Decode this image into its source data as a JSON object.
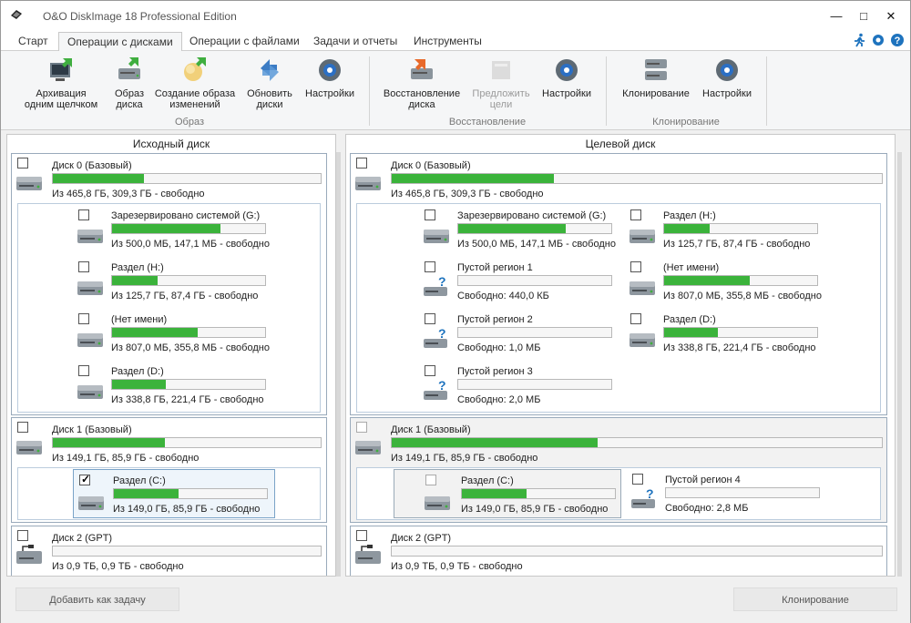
{
  "window": {
    "title": "O&O DiskImage 18 Professional Edition"
  },
  "tabs": [
    "Старт",
    "Операции с дисками",
    "Операции с файлами",
    "Задачи и отчеты",
    "Инструменты"
  ],
  "ribbon": {
    "image": {
      "label": "Образ",
      "one_click": "Архивация\nодним щелчком",
      "image_disk": "Образ\nдиска",
      "image_changes": "Создание образа\nизменений",
      "refresh": "Обновить\nдиски",
      "settings": "Настройки"
    },
    "restore": {
      "label": "Восстановление",
      "restore_disk": "Восстановление\nдиска",
      "suggest": "Предложить\nцели",
      "settings": "Настройки"
    },
    "clone": {
      "label": "Клонирование",
      "clone": "Клонирование",
      "settings": "Настройки"
    }
  },
  "source": {
    "title": "Исходный диск",
    "disk0": {
      "name": "Диск 0 (Базовый)",
      "info": "Из 465,8 ГБ, 309,3 ГБ - свободно",
      "used": 0.34
    },
    "disk0_parts": [
      {
        "name": "Зарезервировано системой (G:)",
        "info": "Из 500,0 МБ, 147,1 МБ - свободно",
        "used": 0.71
      },
      {
        "name": "Раздел (H:)",
        "info": "Из 125,7 ГБ, 87,4 ГБ - свободно",
        "used": 0.3
      },
      {
        "name": "(Нет имени)",
        "info": "Из 807,0 МБ, 355,8 МБ - свободно",
        "used": 0.56
      },
      {
        "name": "Раздел (D:)",
        "info": "Из 338,8 ГБ, 221,4 ГБ - свободно",
        "used": 0.35
      }
    ],
    "disk1": {
      "name": "Диск 1 (Базовый)",
      "info": "Из 149,1 ГБ, 85,9 ГБ - свободно",
      "used": 0.42
    },
    "disk1_part": {
      "name": "Раздел (C:)",
      "info": "Из 149,0 ГБ, 85,9 ГБ - свободно",
      "used": 0.42
    },
    "disk2": {
      "name": "Диск 2 (GPT)",
      "info": "Из 0,9 ТБ, 0,9 ТБ - свободно",
      "used": 0.0
    }
  },
  "target": {
    "title": "Целевой диск",
    "disk0": {
      "name": "Диск 0 (Базовый)",
      "info": "Из 465,8 ГБ, 309,3 ГБ - свободно",
      "used": 0.33
    },
    "disk0_left": [
      {
        "name": "Зарезервировано системой (G:)",
        "info": "Из 500,0 МБ, 147,1 МБ - свободно",
        "used": 0.7,
        "icon": "hdd"
      },
      {
        "name": "Пустой регион 1",
        "info": "Свободно: 440,0 КБ",
        "used": 0.0,
        "icon": "unknown"
      },
      {
        "name": "Пустой регион 2",
        "info": "Свободно: 1,0 МБ",
        "used": 0.0,
        "icon": "unknown"
      },
      {
        "name": "Пустой регион 3",
        "info": "Свободно: 2,0 МБ",
        "used": 0.0,
        "icon": "unknown"
      }
    ],
    "disk0_right": [
      {
        "name": "Раздел (H:)",
        "info": "Из 125,7 ГБ, 87,4 ГБ - свободно",
        "used": 0.3,
        "icon": "hdd"
      },
      {
        "name": "(Нет имени)",
        "info": "Из 807,0 МБ, 355,8 МБ - свободно",
        "used": 0.56,
        "icon": "hdd"
      },
      {
        "name": "Раздел (D:)",
        "info": "Из 338,8 ГБ, 221,4 ГБ - свободно",
        "used": 0.35,
        "icon": "hdd"
      }
    ],
    "disk1": {
      "name": "Диск 1 (Базовый)",
      "info": "Из 149,1 ГБ, 85,9 ГБ - свободно",
      "used": 0.42
    },
    "disk1_part": {
      "name": "Раздел (C:)",
      "info": "Из 149,0 ГБ, 85,9 ГБ - свободно",
      "used": 0.42
    },
    "disk1_empty": {
      "name": "Пустой регион 4",
      "info": "Свободно: 2,8 МБ",
      "used": 0.0
    },
    "disk2": {
      "name": "Диск 2 (GPT)",
      "info": "Из 0,9 ТБ, 0,9 ТБ - свободно",
      "used": 0.0
    }
  },
  "buttons": {
    "add_task": "Добавить как задачу",
    "clone": "Клонирование"
  },
  "colors": {
    "bar_fill": "#3bb33b",
    "accent": "#0078d7"
  }
}
